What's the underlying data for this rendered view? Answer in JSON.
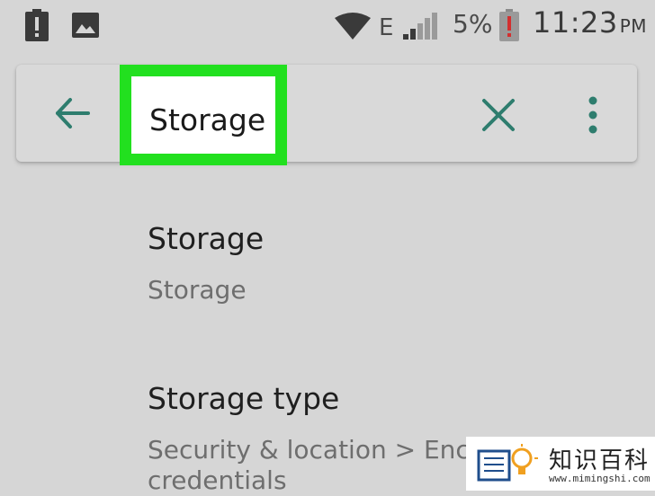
{
  "status_bar": {
    "battery_percent": "5%",
    "network_type": "E",
    "time": "11:23",
    "time_suffix": "PM",
    "icons": [
      "alert-battery-icon",
      "image-icon",
      "wifi-icon",
      "signal-icon",
      "battery-low-icon"
    ]
  },
  "search": {
    "query": "Storage",
    "back_icon": "arrow-left-icon",
    "clear_icon": "close-icon",
    "more_icon": "more-vert-icon",
    "accent_color": "#2e7d6e",
    "highlight_color": "#22e01f"
  },
  "results": [
    {
      "title": "Storage",
      "subtitle": "Storage"
    },
    {
      "title": "Storage type",
      "subtitle": "Security & location > Encr credentials"
    }
  ],
  "watermark": {
    "text": "知识百科",
    "url": "www.mimingshi.com"
  }
}
